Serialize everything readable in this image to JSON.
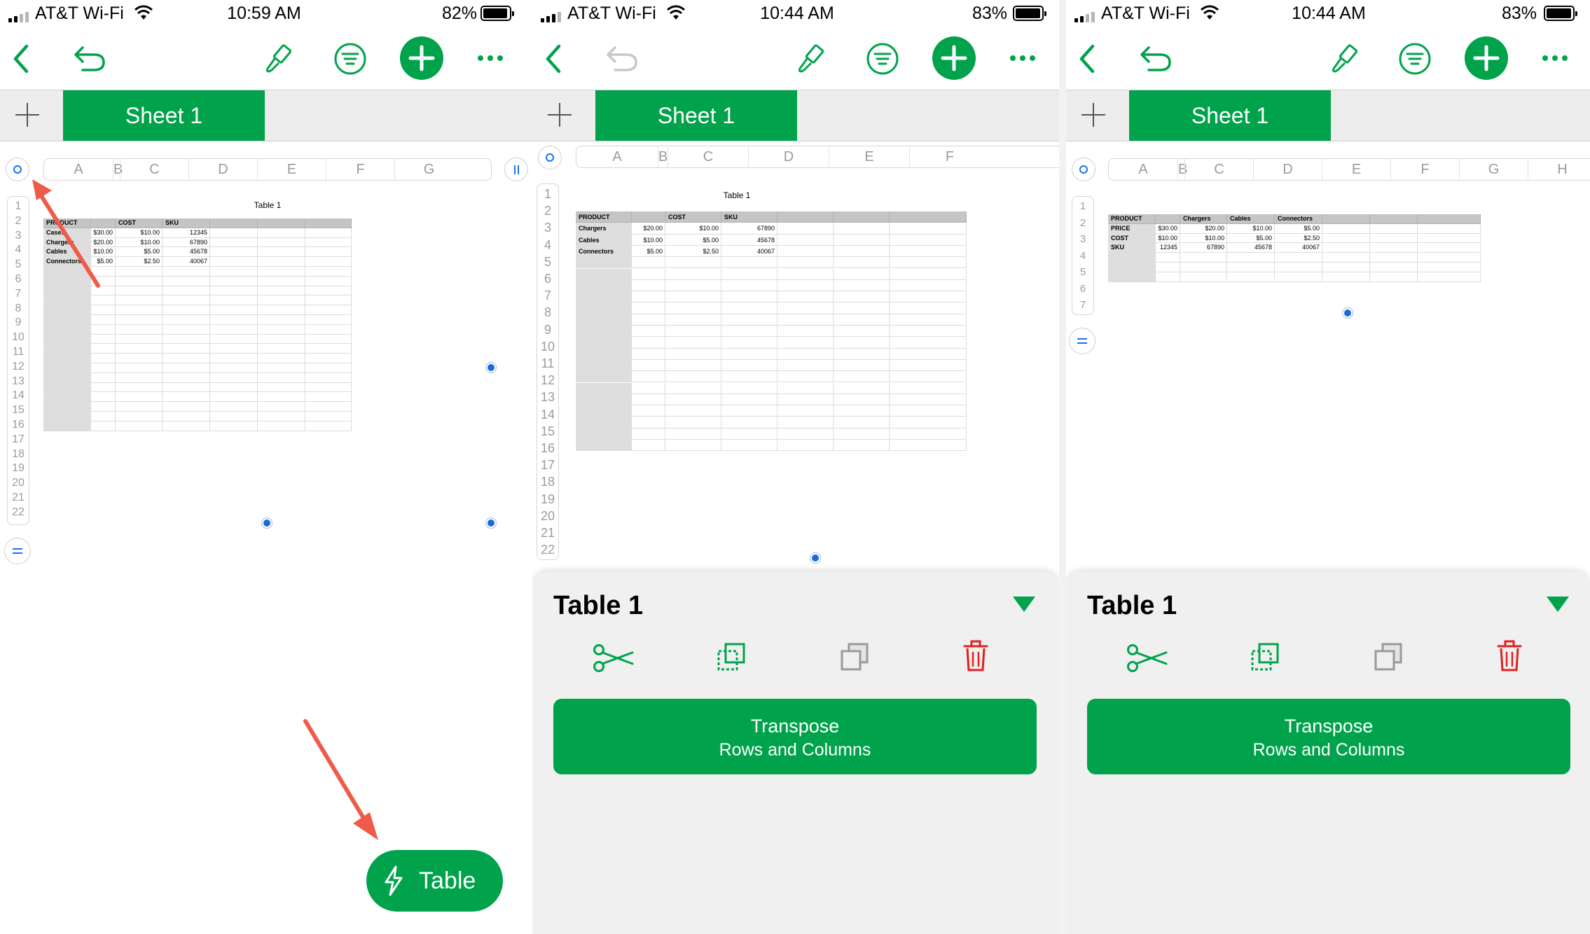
{
  "panels": [
    {
      "status": {
        "carrier": "AT&T Wi-Fi",
        "time": "10:59 AM",
        "battery": "82%"
      },
      "sheet_tab": "Sheet 1",
      "columns": [
        "A",
        "B",
        "C",
        "D",
        "E",
        "F",
        "G"
      ],
      "rows": [
        "1",
        "2",
        "3",
        "4",
        "5",
        "6",
        "7",
        "8",
        "9",
        "10",
        "11",
        "12",
        "13",
        "14",
        "15",
        "16",
        "17",
        "18",
        "19",
        "20",
        "21",
        "22"
      ],
      "table": {
        "title": "Table 1",
        "headers": [
          "PRODUCT",
          "",
          "COST",
          "SKU",
          "",
          "",
          ""
        ],
        "data": [
          [
            "Cases",
            "$30.00",
            "$10.00",
            "12345"
          ],
          [
            "Chargers",
            "$20.00",
            "$10.00",
            "67890"
          ],
          [
            "Cables",
            "$10.00",
            "$5.00",
            "45678"
          ],
          [
            "Connectors",
            "$5.00",
            "$2.50",
            "40067"
          ]
        ]
      },
      "quick_button": "Table"
    },
    {
      "status": {
        "carrier": "AT&T Wi-Fi",
        "time": "10:44 AM",
        "battery": "83%"
      },
      "sheet_tab": "Sheet 1",
      "columns": [
        "A",
        "B",
        "C",
        "D",
        "E",
        "F"
      ],
      "rows": [
        "1",
        "2",
        "3",
        "4",
        "5",
        "6",
        "7",
        "8",
        "9",
        "10",
        "11",
        "12",
        "13",
        "14",
        "15",
        "16",
        "17",
        "18",
        "19",
        "20",
        "21",
        "22"
      ],
      "table": {
        "title": "Table 1",
        "headers": [
          "PRODUCT",
          "",
          "COST",
          "SKU",
          "",
          ""
        ],
        "data": [
          [
            "Chargers",
            "$20.00",
            "$10.00",
            "67890"
          ],
          [
            "Cables",
            "$10.00",
            "$5.00",
            "45678"
          ],
          [
            "Connectors",
            "$5.00",
            "$2.50",
            "40067"
          ]
        ]
      },
      "bottom_sheet": {
        "title": "Table 1",
        "transpose_line1": "Transpose",
        "transpose_line2": "Rows and Columns"
      }
    },
    {
      "status": {
        "carrier": "AT&T Wi-Fi",
        "time": "10:44 AM",
        "battery": "83%"
      },
      "sheet_tab": "Sheet 1",
      "columns": [
        "A",
        "B",
        "C",
        "D",
        "E",
        "F",
        "G",
        "H"
      ],
      "rows": [
        "1",
        "2",
        "3",
        "4",
        "5",
        "6",
        "7"
      ],
      "table": {
        "headers": [
          "PRODUCT",
          "",
          "Chargers",
          "Cables",
          "Connectors",
          "",
          ""
        ],
        "data": [
          [
            "PRICE",
            "$30.00",
            "$20.00",
            "$10.00",
            "$5.00"
          ],
          [
            "COST",
            "$10.00",
            "$10.00",
            "$5.00",
            "$2.50"
          ],
          [
            "SKU",
            "12345",
            "67890",
            "45678",
            "40067"
          ]
        ]
      },
      "bottom_sheet": {
        "title": "Table 1",
        "transpose_line1": "Transpose",
        "transpose_line2": "Rows and Columns"
      }
    }
  ],
  "colors": {
    "accent": "#00a34b",
    "delete": "#e02020",
    "handle": "#1a6ad8",
    "arrow": "#f05a4a"
  },
  "icons": [
    "back-chevron-icon",
    "undo-icon",
    "paintbrush-icon",
    "filter-icon",
    "plus-icon",
    "more-icon",
    "scissors-icon",
    "copy-icon",
    "paste-icon",
    "trash-icon",
    "bolt-icon"
  ]
}
